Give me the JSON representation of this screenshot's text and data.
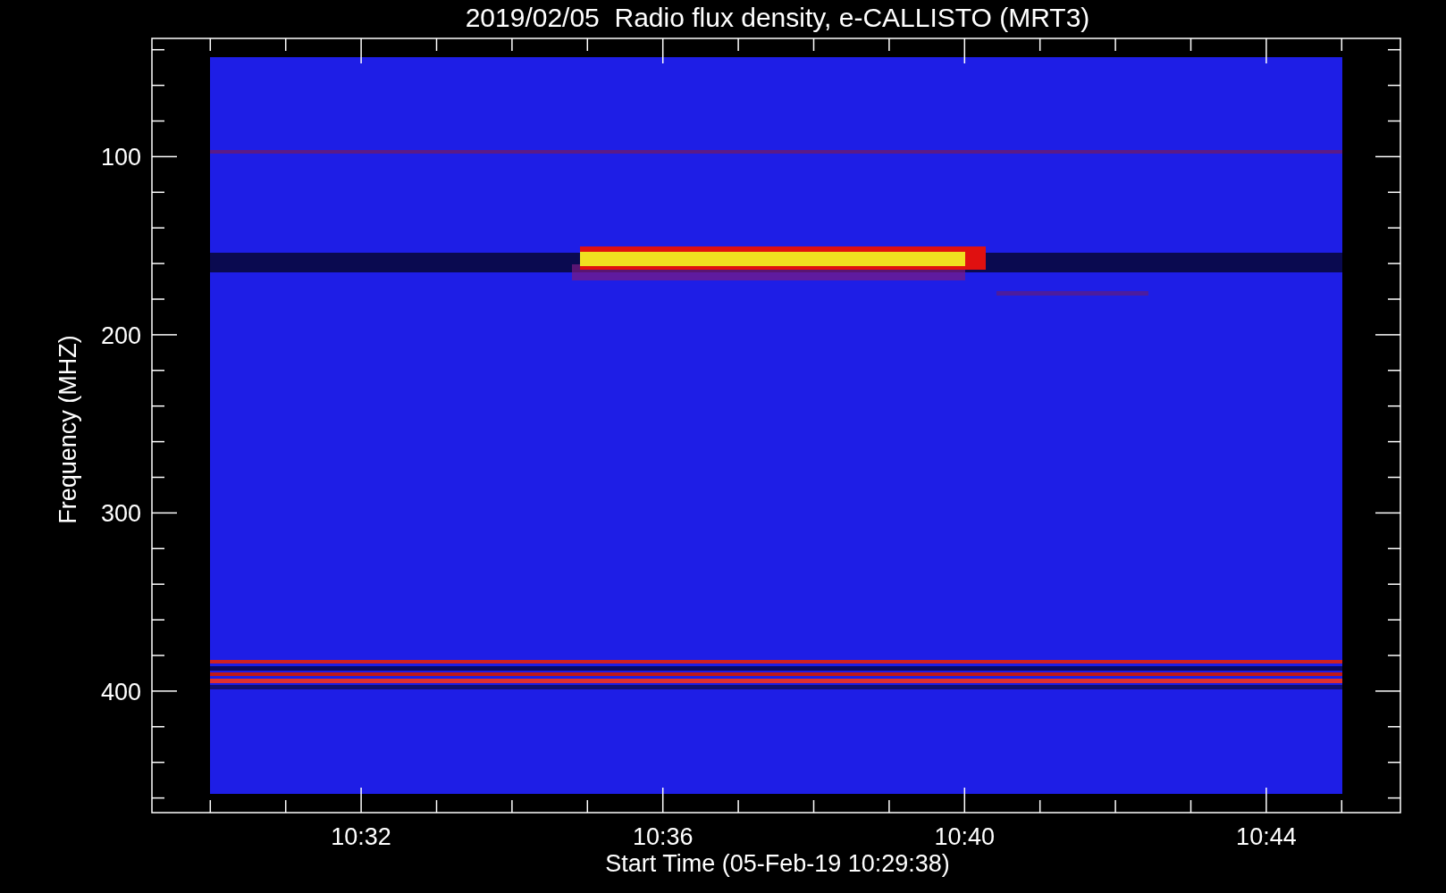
{
  "title": "2019/02/05  Radio flux density, e-CALLISTO (MRT3)",
  "y_axis": {
    "label": "Frequency (MHZ)",
    "ticks": [
      "100",
      "200",
      "300",
      "400"
    ]
  },
  "x_axis": {
    "label": "Start Time (05-Feb-19 10:29:38)",
    "ticks": [
      "10:32",
      "10:36",
      "10:40",
      "10:44"
    ]
  }
}
